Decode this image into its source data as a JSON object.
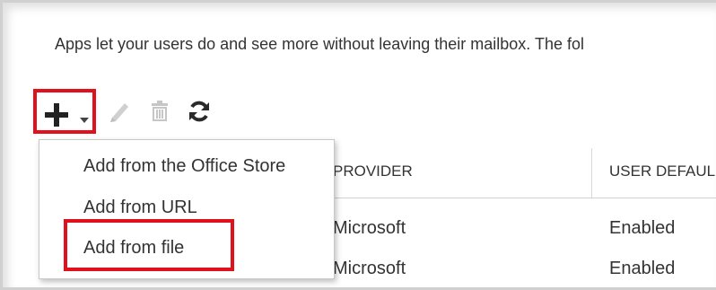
{
  "intro_text": "Apps let your users do and see more without leaving their mailbox. The fol",
  "toolbar": {
    "add": {
      "icon": "plus-icon",
      "caret_icon": "chevron-down-icon"
    },
    "edit": {
      "icon": "pencil-icon"
    },
    "delete": {
      "icon": "trash-icon"
    },
    "refresh": {
      "icon": "refresh-icon"
    }
  },
  "add_menu": {
    "items": [
      {
        "label": "Add from the Office Store"
      },
      {
        "label": "Add from URL"
      },
      {
        "label": "Add from file"
      }
    ]
  },
  "table": {
    "columns": [
      "PROVIDER",
      "USER DEFAUL"
    ],
    "rows": [
      {
        "provider": "Microsoft",
        "user_default": "Enabled"
      },
      {
        "provider": "Microsoft",
        "user_default": "Enabled"
      }
    ]
  },
  "colors": {
    "highlight": "#e0111d",
    "text": "#333333",
    "disabled_icon": "#c4c4c4",
    "icon": "#333333"
  }
}
